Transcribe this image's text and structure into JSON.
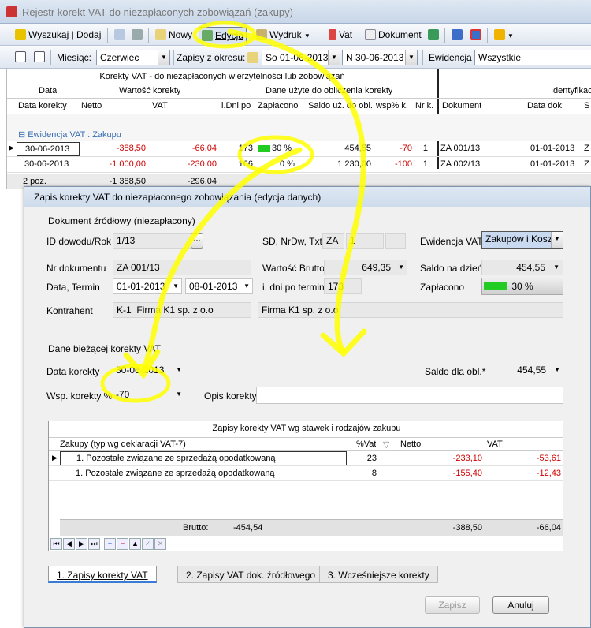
{
  "app": {
    "title": "Rejestr korekt VAT do niezapłaconych zobowiązań (zakupy)"
  },
  "toolbar": {
    "search": "Wyszukaj | Dodaj",
    "new": "Nowy",
    "edit": "Edycja",
    "print": "Wydruk",
    "vat": "Vat",
    "document": "Dokument"
  },
  "filters": {
    "month_label": "Miesiąc:",
    "month": "Czerwiec",
    "period_label": "Zapisy z okresu:",
    "from": "So 01-06-2013",
    "to": "N 30-06-2013",
    "evid_label": "Ewidencja",
    "evid": "Wszystkie"
  },
  "grid": {
    "title": "Korekty VAT - do niezapłaconych wierzytelności lub zobowiązań",
    "group_data": "Data",
    "group_value": "Wartość korekty",
    "group_used": "Dane użyte do obliczenia korekty",
    "group_ident": "Identyfikac",
    "cols": {
      "date": "Data korekty",
      "net": "Netto",
      "vat": "VAT",
      "days": "i.Dni po",
      "paid": "Zapłacono",
      "saldo": "Saldo uż. do obl.",
      "wsp": "wsp% k.",
      "nr": "Nr k.",
      "doc": "Dokument",
      "docdate": "Data dok.",
      "s": "S"
    },
    "group_row": "Ewidencja VAT : Zakupu",
    "rows": [
      {
        "date": "30-06-2013",
        "net": "-388,50",
        "vat": "-66,04",
        "days": "173",
        "paid": "30 %",
        "paid_pct": 30,
        "saldo": "454,55",
        "wsp": "-70",
        "nr": "1",
        "doc": "ZA 001/13",
        "docdate": "01-01-2013",
        "s": "Z"
      },
      {
        "date": "30-06-2013",
        "net": "-1 000,00",
        "vat": "-230,00",
        "days": "166",
        "paid": "0 %",
        "paid_pct": 0,
        "saldo": "1 230,00",
        "wsp": "-100",
        "nr": "1",
        "doc": "ZA 002/13",
        "docdate": "01-01-2013",
        "s": "Z"
      }
    ],
    "footer": {
      "count": "2 poz.",
      "net": "-1 388,50",
      "vat": "-296,04"
    }
  },
  "dialog": {
    "title": "Zapis korekty VAT do niezapłaconego zobowiązania (edycja danych)",
    "sec1": "Dokument źródłowy  (niezapłacony)",
    "id_label": "ID dowodu/Rok",
    "id": "1/13",
    "sd_label": "SD, NrDw, Txt",
    "sd": "ZA",
    "nrdw": "1",
    "evid_label": "Ewidencja VAT",
    "evid": "Zakupów i Koszt",
    "nr_label": "Nr dokumentu",
    "nr": "ZA 001/13",
    "brutto_label": "Wartość Brutto",
    "brutto": "649,35",
    "saldo_label": "Saldo na dzień*",
    "saldo": "454,55",
    "date_label": "Data, Termin",
    "date": "01-01-2013",
    "term": "08-01-2013",
    "days_label": "i. dni po terminie",
    "days": "173",
    "paid_label": "Zapłacono",
    "paid": "30 %",
    "paid_pct": 30,
    "contr_label": "Kontrahent",
    "contr_code": "K-1",
    "contr_name": "Firma K1 sp. z o.o",
    "contr_full": "Firma K1 sp. z o.o",
    "sec2": "Dane bieżącej korekty VAT",
    "kdate_label": "Data korekty",
    "kdate": "30-06-2013",
    "saldo2_label": "Saldo dla obl.*",
    "saldo2": "454,55",
    "wsp_label": "Wsp. korekty %",
    "wsp": "-70",
    "opis_label": "Opis korekty",
    "opis": "",
    "sub_title": "Zapisy korekty VAT  wg stawek i rodzajów zakupu",
    "sub_cols": {
      "type": "Zakupy (typ wg deklaracji VAT-7)",
      "rate": "%Vat",
      "net": "Netto",
      "vat": "VAT"
    },
    "sub_rows": [
      {
        "type": "1. Pozostałe związane ze sprzedażą opodatkowaną",
        "rate": "23",
        "net": "-233,10",
        "vat": "-53,61"
      },
      {
        "type": "1. Pozostałe związane ze sprzedażą opodatkowaną",
        "rate": "8",
        "net": "-155,40",
        "vat": "-12,43"
      }
    ],
    "sub_footer": {
      "brutto_label": "Brutto:",
      "brutto": "-454,54",
      "net": "-388,50",
      "vat": "-66,04"
    },
    "tabs": [
      "1. Zapisy korekty VAT",
      "2. Zapisy VAT dok. źródłowego",
      "3. Wcześniejsze korekty"
    ],
    "save": "Zapisz",
    "cancel": "Anuluj"
  },
  "colors": {
    "accent": "#ffff00",
    "red": "#d00000",
    "progress": "#22cc22"
  }
}
